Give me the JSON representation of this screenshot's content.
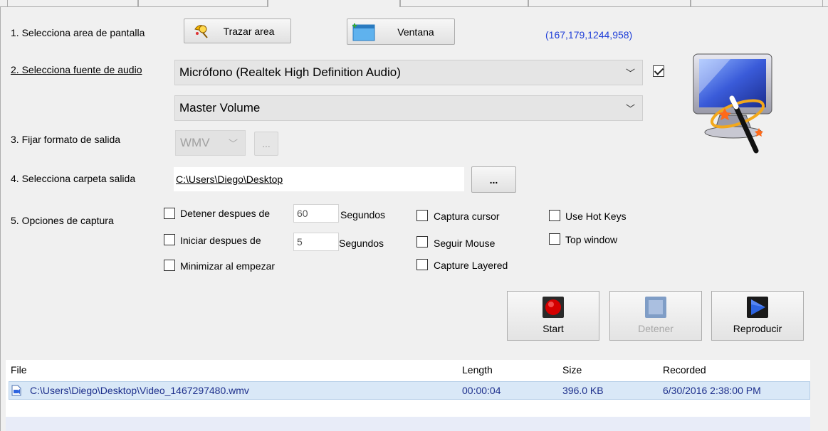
{
  "step1": {
    "label": "1. Selecciona area de pantalla",
    "trace_button": "Trazar area",
    "window_button": "Ventana",
    "coords": "(167,179,1244,958)"
  },
  "step2": {
    "label": "2. Selecciona fuente de audio",
    "source": "Micrófono (Realtek High Definition Audio)",
    "mixer": "Master Volume",
    "enabled": true
  },
  "step3": {
    "label": "3. Fijar formato de salida",
    "format": "WMV",
    "options_button": "..."
  },
  "step4": {
    "label": "4. Selecciona carpeta salida",
    "folder": "C:\\Users\\Diego\\Desktop",
    "browse_button": "..."
  },
  "step5": {
    "label": "5. Opciones de captura",
    "stop_after": {
      "label": "Detener despues de",
      "value": "60",
      "unit": "Segundos",
      "checked": false
    },
    "start_after": {
      "label": "Iniciar despues de",
      "value": "5",
      "unit": "Segundos",
      "checked": false
    },
    "minimize": {
      "label": "Minimizar al empezar",
      "checked": false
    },
    "capture_cursor": {
      "label": "Captura cursor",
      "checked": false
    },
    "follow_mouse": {
      "label": "Seguir Mouse",
      "checked": false
    },
    "capture_layered": {
      "label": "Capture Layered",
      "checked": false
    },
    "hot_keys": {
      "label": "Use Hot Keys",
      "checked": false
    },
    "top_window": {
      "label": "Top window",
      "checked": false
    }
  },
  "controls": {
    "start": "Start",
    "stop": "Detener",
    "play": "Reproducir"
  },
  "files": {
    "headers": [
      "File",
      "Length",
      "Size",
      "Recorded"
    ],
    "rows": [
      {
        "file": "C:\\Users\\Diego\\Desktop\\Video_1467297480.wmv",
        "length": "00:00:04",
        "size": "396.0 KB",
        "recorded": "6/30/2016 2:38:00 PM"
      }
    ]
  },
  "colors": {
    "accent": "#1f3fd8",
    "selection": "#d9e8f7",
    "record_red": "#d40000"
  }
}
